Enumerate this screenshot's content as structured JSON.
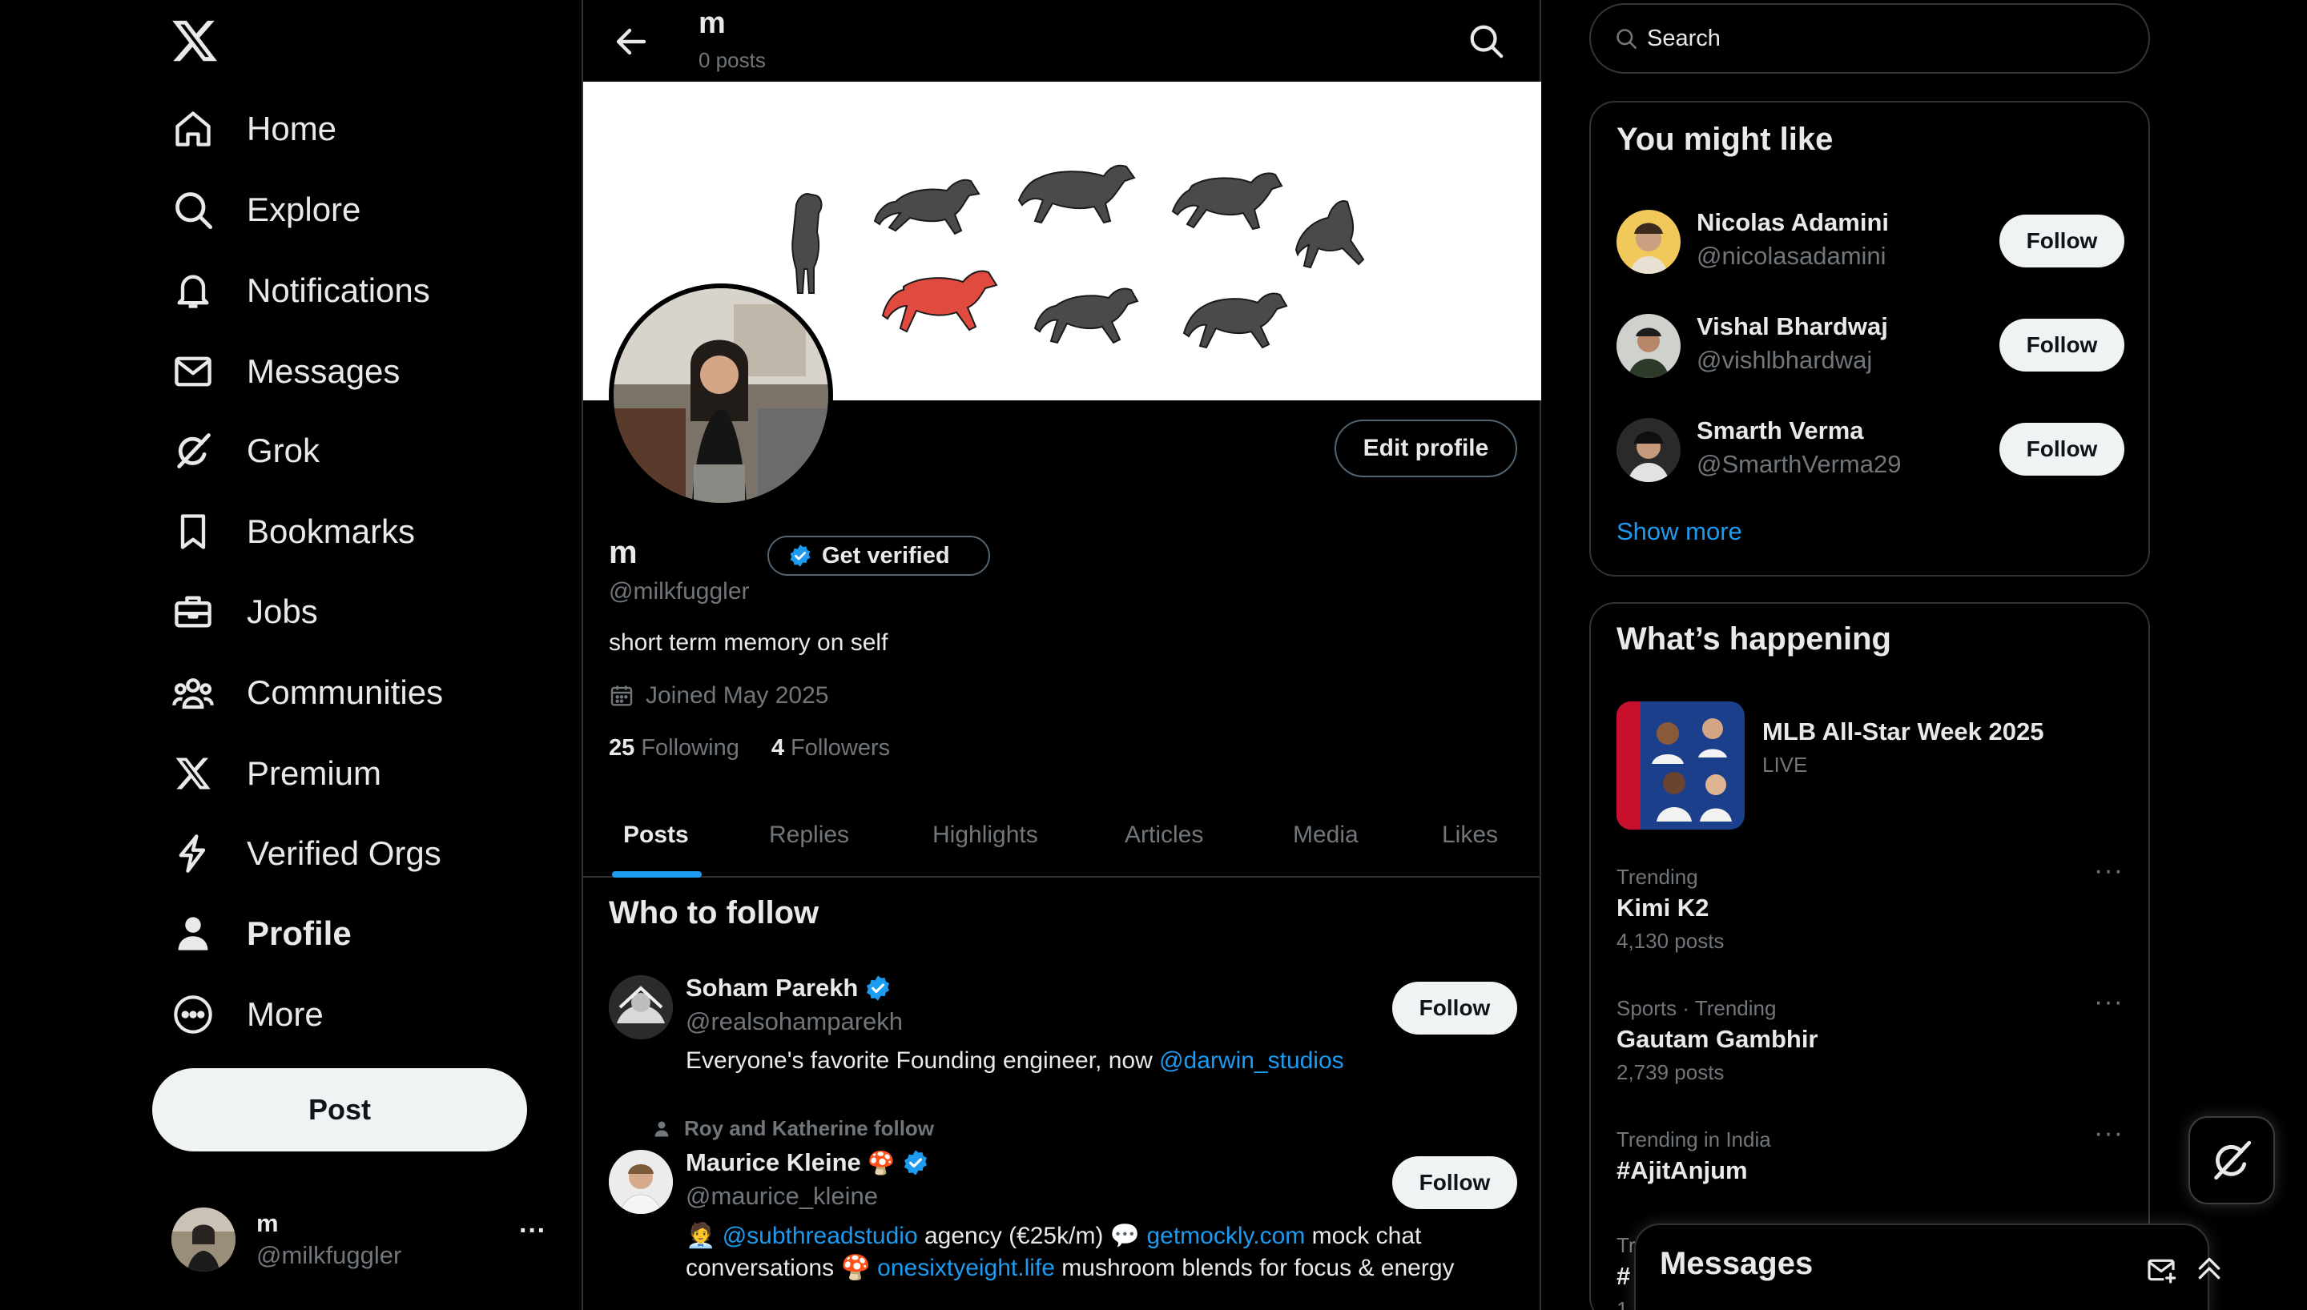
{
  "nav": {
    "items": [
      {
        "label": "Home",
        "icon": "home-icon"
      },
      {
        "label": "Explore",
        "icon": "search-icon"
      },
      {
        "label": "Notifications",
        "icon": "bell-icon"
      },
      {
        "label": "Messages",
        "icon": "envelope-icon"
      },
      {
        "label": "Grok",
        "icon": "grok-icon"
      },
      {
        "label": "Bookmarks",
        "icon": "bookmark-icon"
      },
      {
        "label": "Jobs",
        "icon": "briefcase-icon"
      },
      {
        "label": "Communities",
        "icon": "people-icon"
      },
      {
        "label": "Premium",
        "icon": "x-logo-icon"
      },
      {
        "label": "Verified Orgs",
        "icon": "lightning-icon"
      },
      {
        "label": "Profile",
        "icon": "person-icon"
      },
      {
        "label": "More",
        "icon": "more-circle-icon"
      }
    ],
    "active": "Profile",
    "post_label": "Post"
  },
  "account": {
    "name": "m",
    "handle": "@milkfuggler",
    "more": "···"
  },
  "header": {
    "name": "m",
    "posts_count": "0 posts"
  },
  "profile": {
    "name": "m",
    "get_verified": "Get verified",
    "handle": "@milkfuggler",
    "bio": "short term memory on self",
    "joined": "Joined May 2025",
    "following_count": "25",
    "following_label": "Following",
    "followers_count": "4",
    "followers_label": "Followers",
    "edit_label": "Edit profile"
  },
  "tabs": [
    "Posts",
    "Replies",
    "Highlights",
    "Articles",
    "Media",
    "Likes"
  ],
  "who_to_follow": {
    "title": "Who to follow",
    "follow_label": "Follow",
    "users": [
      {
        "name": "Soham Parekh",
        "handle": "@realsohamparekh",
        "bio_text": "Everyone's favorite Founding engineer, now ",
        "bio_link": "@darwin_studios"
      },
      {
        "context": "Roy and Katherine follow",
        "name": "Maurice Kleine",
        "name_emoji": "🍄",
        "handle": "@maurice_kleine",
        "bio_line1": {
          "emoji1": "🧑‍💼",
          "link1": "@subthreadstudio",
          "text1": " agency (€25k/m) ",
          "emoji2": "💬",
          "link2": "getmockly.com",
          "text2": " mock chat"
        },
        "bio_line2": {
          "text1": "conversations ",
          "emoji": "🍄",
          "link": "onesixtyeight.life",
          "text2": " mushroom blends for focus & energy"
        }
      }
    ]
  },
  "right": {
    "search_placeholder": "Search",
    "you_might_like": {
      "title": "You might like",
      "follow_label": "Follow",
      "users": [
        {
          "name": "Nicolas Adamini",
          "handle": "@nicolasadamini"
        },
        {
          "name": "Vishal Bhardwaj",
          "handle": "@vishlbhardwaj"
        },
        {
          "name": "Smarth Verma",
          "handle": "@SmarthVerma29"
        }
      ],
      "show_more": "Show more"
    },
    "whats_happening": {
      "title": "What’s happening",
      "featured": {
        "title": "MLB All-Star Week 2025",
        "status": "LIVE"
      },
      "trends": [
        {
          "meta": "Trending",
          "title": "Kimi K2",
          "posts": "4,130 posts"
        },
        {
          "meta": "Sports · Trending",
          "title": "Gautam Gambhir",
          "posts": "2,739 posts"
        },
        {
          "meta": "Trending in India",
          "title": "#AjitAnjum",
          "posts": ""
        }
      ],
      "partial_meta": "Tr",
      "partial_title": "#",
      "partial_posts": "1"
    }
  },
  "messages_drawer": {
    "title": "Messages"
  },
  "colors": {
    "accent": "#1d9bf0",
    "background": "#000000",
    "muted": "#71767b",
    "border": "#2f3336"
  }
}
